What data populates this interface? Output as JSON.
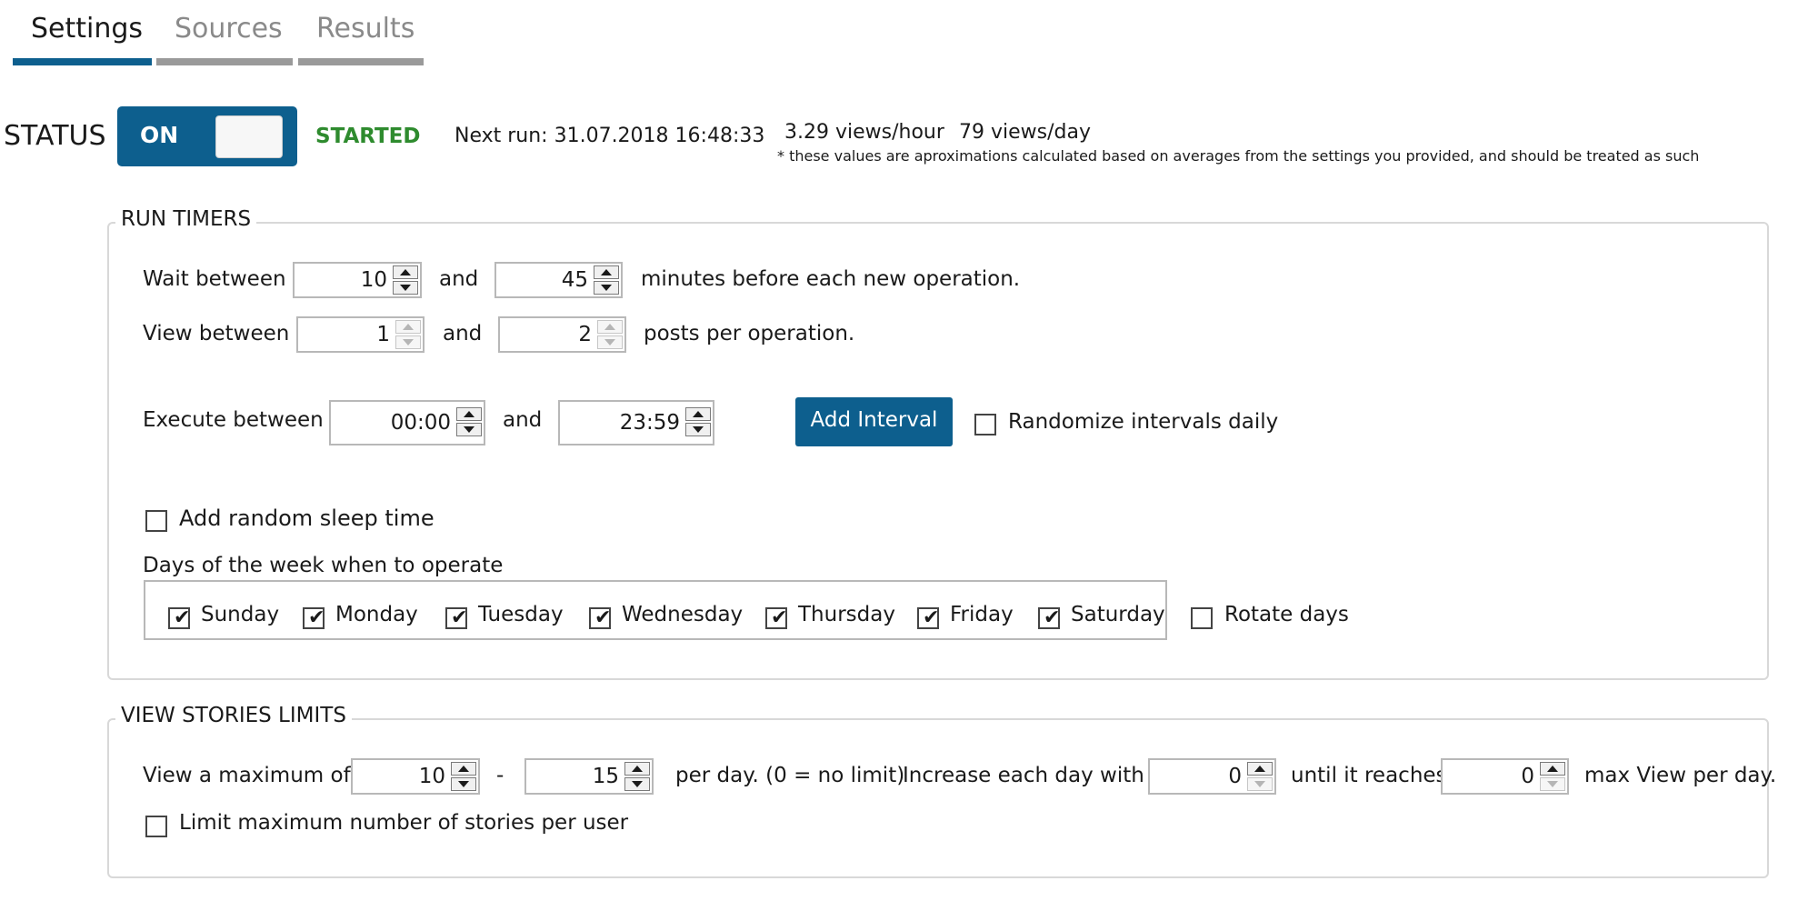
{
  "tabs": [
    {
      "label": "Settings",
      "active": true
    },
    {
      "label": "Sources",
      "active": false
    },
    {
      "label": "Results",
      "active": false
    }
  ],
  "colors": {
    "accent": "#0d5f8e",
    "started": "#2e8b2e",
    "tab_inactive": "#8a8a8a"
  },
  "status": {
    "label": "STATUS",
    "toggle_label": "ON",
    "toggle_on": true,
    "state": "STARTED",
    "next_run": "Next run: 31.07.2018 16:48:33",
    "views_hour": "3.29 views/hour",
    "views_day": "79 views/day",
    "note": "* these values are aproximations calculated based on averages from the settings you provided, and should be treated as such"
  },
  "run_timers": {
    "title": "RUN TIMERS",
    "wait": {
      "label": "Wait between",
      "min": "10",
      "and": "and",
      "max": "45",
      "suffix": "minutes before each new operation."
    },
    "view": {
      "label": "View between",
      "min": "1",
      "and": "and",
      "max": "2",
      "suffix": "posts per operation."
    },
    "execute": {
      "label": "Execute between",
      "start": "00:00",
      "and": "and",
      "end": "23:59"
    },
    "add_interval": "Add Interval",
    "randomize_intervals": {
      "label": "Randomize intervals daily",
      "checked": false
    },
    "random_sleep": {
      "label": "Add random sleep time",
      "checked": false
    },
    "days_label": "Days of the week when to operate",
    "days": [
      {
        "label": "Sunday",
        "checked": true
      },
      {
        "label": "Monday",
        "checked": true
      },
      {
        "label": "Tuesday",
        "checked": true
      },
      {
        "label": "Wednesday",
        "checked": true
      },
      {
        "label": "Thursday",
        "checked": true
      },
      {
        "label": "Friday",
        "checked": true
      },
      {
        "label": "Saturday",
        "checked": true
      }
    ],
    "rotate_days": {
      "label": "Rotate days",
      "checked": false
    }
  },
  "limits": {
    "title": "VIEW STORIES LIMITS",
    "label": "View a maximum of",
    "min": "10",
    "dash": "-",
    "max": "15",
    "per_day": "per day. (0 = no limit)",
    "increase_label": "Increase each day with",
    "increase": "0",
    "until_label": "until it reaches",
    "until": "0",
    "max_suffix": "max View per day.",
    "limit_per_user": {
      "label": "Limit maximum number of stories per user",
      "checked": false
    }
  }
}
